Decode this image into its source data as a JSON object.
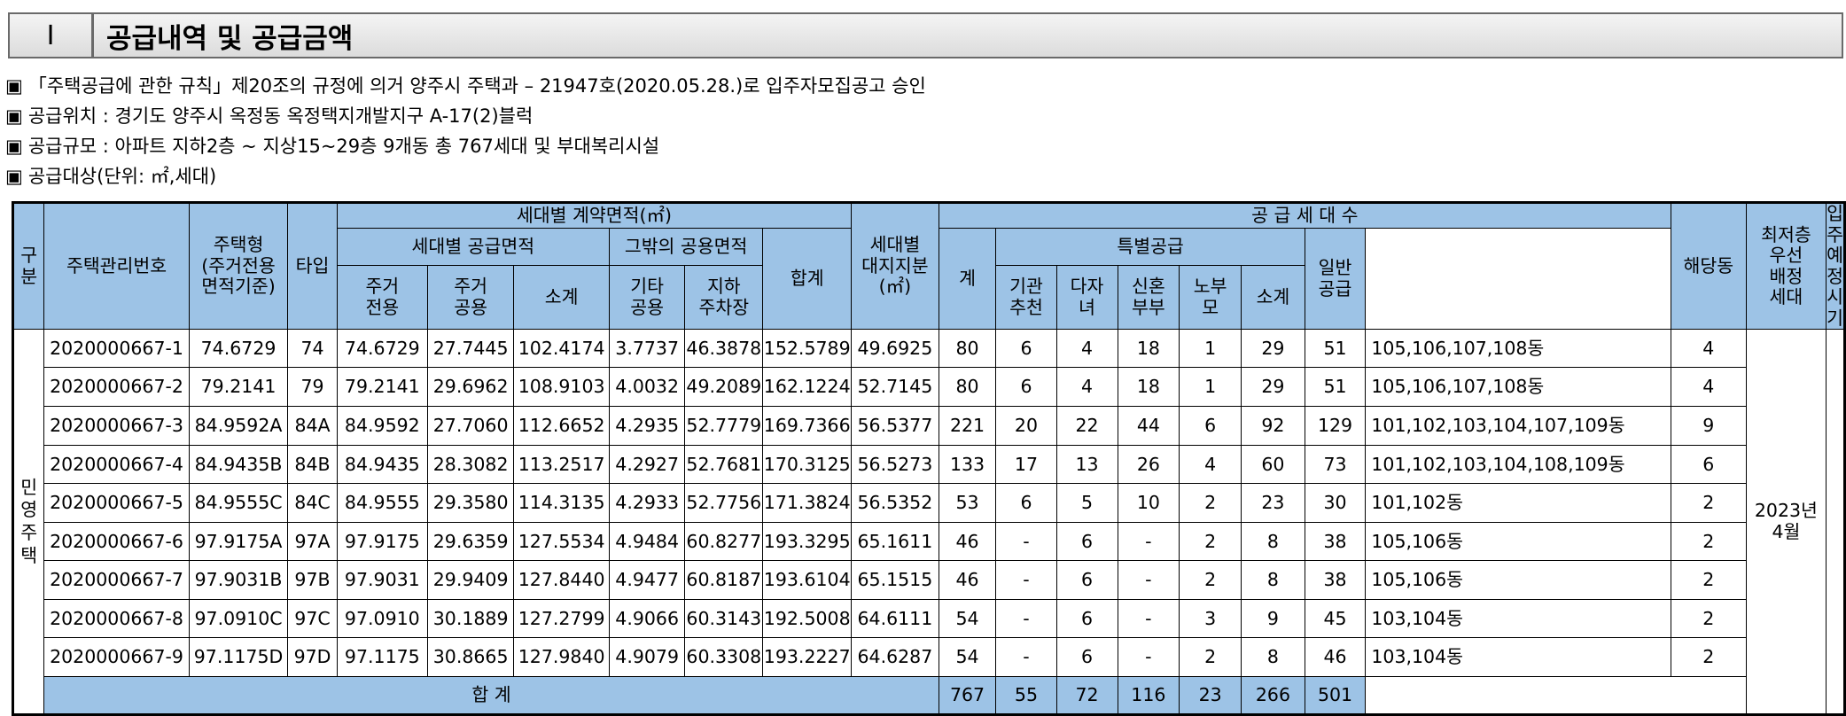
{
  "header": {
    "number": "Ⅰ",
    "title": "공급내역 및 공급금액"
  },
  "notes": [
    {
      "bullet": "▣",
      "text": "「주택공급에 관한 규칙」제20조의 규정에 의거 양주시 주택과 – 21947호(2020.05.28.)로 입주자모집공고 승인"
    },
    {
      "bullet": "▣",
      "text": "공급위치 : 경기도 양주시 옥정동 옥정택지개발지구 A-17(2)블럭"
    },
    {
      "bullet": "▣",
      "text": "공급규모 : 아파트 지하2층 ~ 지상15~29층 9개동 총 767세대 및 부대복리시설"
    },
    {
      "bullet": "▣",
      "text": "공급대상(단위: ㎡,세대)"
    }
  ],
  "table": {
    "headers": {
      "category": "구\n분",
      "mgmt_no": "주택관리번호",
      "housing_type": "주택형\n(주거전용\n면적기준)",
      "type": "타입",
      "contract_area": "세대별 계약면적(㎡)",
      "supply_area": "세대별 공급면적",
      "exclusive": "주거\n전용",
      "common": "주거\n공용",
      "subtotal": "소계",
      "other_common": "그밖의 공용면적",
      "other": "기타\n공용",
      "parking": "지하\n주차장",
      "total": "합계",
      "land_share": "세대별\n대지지분\n(㎡)",
      "supply_units": "공 급 세 대 수",
      "units_total": "계",
      "special": "특별공급",
      "institution": "기관\n추천",
      "multi_child": "다자\n녀",
      "newlywed": "신혼\n부부",
      "elderly": "노부\n모",
      "special_subtotal": "소계",
      "general": "일반\n공급",
      "buildings": "해당동",
      "lowest_floor": "최저층\n우선\n배정\n세대",
      "move_in": "입주\n예정\n시기"
    },
    "category_label": "민\n영\n주\n택",
    "move_in_value": "2023년\n4월",
    "rows": [
      {
        "mgmt_no": "2020000667-1",
        "housing_type": "74.6729",
        "type": "74",
        "exclusive": "74.6729",
        "common": "27.7445",
        "subtotal": "102.4174",
        "other": "3.7737",
        "parking": "46.3878",
        "total": "152.5789",
        "land": "49.6925",
        "units": "80",
        "inst": "6",
        "multi": "4",
        "newly": "18",
        "elder": "1",
        "spsub": "29",
        "general": "51",
        "buildings": "105,106,107,108동",
        "lowest": "4"
      },
      {
        "mgmt_no": "2020000667-2",
        "housing_type": "79.2141",
        "type": "79",
        "exclusive": "79.2141",
        "common": "29.6962",
        "subtotal": "108.9103",
        "other": "4.0032",
        "parking": "49.2089",
        "total": "162.1224",
        "land": "52.7145",
        "units": "80",
        "inst": "6",
        "multi": "4",
        "newly": "18",
        "elder": "1",
        "spsub": "29",
        "general": "51",
        "buildings": "105,106,107,108동",
        "lowest": "4"
      },
      {
        "mgmt_no": "2020000667-3",
        "housing_type": "84.9592A",
        "type": "84A",
        "exclusive": "84.9592",
        "common": "27.7060",
        "subtotal": "112.6652",
        "other": "4.2935",
        "parking": "52.7779",
        "total": "169.7366",
        "land": "56.5377",
        "units": "221",
        "inst": "20",
        "multi": "22",
        "newly": "44",
        "elder": "6",
        "spsub": "92",
        "general": "129",
        "buildings": "101,102,103,104,107,109동",
        "lowest": "9"
      },
      {
        "mgmt_no": "2020000667-4",
        "housing_type": "84.9435B",
        "type": "84B",
        "exclusive": "84.9435",
        "common": "28.3082",
        "subtotal": "113.2517",
        "other": "4.2927",
        "parking": "52.7681",
        "total": "170.3125",
        "land": "56.5273",
        "units": "133",
        "inst": "17",
        "multi": "13",
        "newly": "26",
        "elder": "4",
        "spsub": "60",
        "general": "73",
        "buildings": "101,102,103,104,108,109동",
        "lowest": "6"
      },
      {
        "mgmt_no": "2020000667-5",
        "housing_type": "84.9555C",
        "type": "84C",
        "exclusive": "84.9555",
        "common": "29.3580",
        "subtotal": "114.3135",
        "other": "4.2933",
        "parking": "52.7756",
        "total": "171.3824",
        "land": "56.5352",
        "units": "53",
        "inst": "6",
        "multi": "5",
        "newly": "10",
        "elder": "2",
        "spsub": "23",
        "general": "30",
        "buildings": "101,102동",
        "lowest": "2"
      },
      {
        "mgmt_no": "2020000667-6",
        "housing_type": "97.9175A",
        "type": "97A",
        "exclusive": "97.9175",
        "common": "29.6359",
        "subtotal": "127.5534",
        "other": "4.9484",
        "parking": "60.8277",
        "total": "193.3295",
        "land": "65.1611",
        "units": "46",
        "inst": "-",
        "multi": "6",
        "newly": "-",
        "elder": "2",
        "spsub": "8",
        "general": "38",
        "buildings": "105,106동",
        "lowest": "2"
      },
      {
        "mgmt_no": "2020000667-7",
        "housing_type": "97.9031B",
        "type": "97B",
        "exclusive": "97.9031",
        "common": "29.9409",
        "subtotal": "127.8440",
        "other": "4.9477",
        "parking": "60.8187",
        "total": "193.6104",
        "land": "65.1515",
        "units": "46",
        "inst": "-",
        "multi": "6",
        "newly": "-",
        "elder": "2",
        "spsub": "8",
        "general": "38",
        "buildings": "105,106동",
        "lowest": "2"
      },
      {
        "mgmt_no": "2020000667-8",
        "housing_type": "97.0910C",
        "type": "97C",
        "exclusive": "97.0910",
        "common": "30.1889",
        "subtotal": "127.2799",
        "other": "4.9066",
        "parking": "60.3143",
        "total": "192.5008",
        "land": "64.6111",
        "units": "54",
        "inst": "-",
        "multi": "6",
        "newly": "-",
        "elder": "3",
        "spsub": "9",
        "general": "45",
        "buildings": "103,104동",
        "lowest": "2"
      },
      {
        "mgmt_no": "2020000667-9",
        "housing_type": "97.1175D",
        "type": "97D",
        "exclusive": "97.1175",
        "common": "30.8665",
        "subtotal": "127.9840",
        "other": "4.9079",
        "parking": "60.3308",
        "total": "193.2227",
        "land": "64.6287",
        "units": "54",
        "inst": "-",
        "multi": "6",
        "newly": "-",
        "elder": "2",
        "spsub": "8",
        "general": "46",
        "buildings": "103,104동",
        "lowest": "2"
      }
    ],
    "totals": {
      "label": "합 계",
      "units": "767",
      "inst": "55",
      "multi": "72",
      "newly": "116",
      "elder": "23",
      "spsub": "266",
      "general": "501"
    }
  }
}
